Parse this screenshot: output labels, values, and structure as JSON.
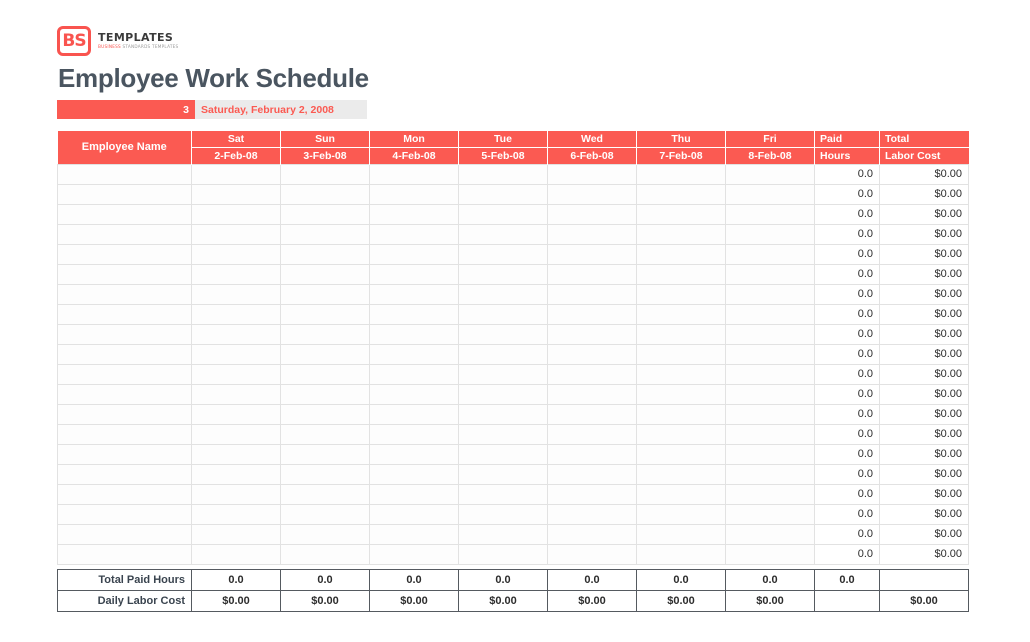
{
  "brand": {
    "mark_text": "BS",
    "name": "TEMPLATES",
    "tagline_accent": "BUSINESS",
    "tagline_rest": " STANDARDS TEMPLATES"
  },
  "header": {
    "title": "Employee Work Schedule",
    "week_number": "3",
    "week_start_date": "Saturday, February 2, 2008"
  },
  "colors": {
    "accent_red": "#fb5a52",
    "banner_gray": "#ebebeb",
    "title_gray": "#4a5560",
    "grid_line": "#e2e2e2",
    "footer_border": "#555a60"
  },
  "table": {
    "employee_col_header": "Employee Name",
    "day_headers": [
      {
        "day": "Sat",
        "date": "2-Feb-08"
      },
      {
        "day": "Sun",
        "date": "3-Feb-08"
      },
      {
        "day": "Mon",
        "date": "4-Feb-08"
      },
      {
        "day": "Tue",
        "date": "5-Feb-08"
      },
      {
        "day": "Wed",
        "date": "6-Feb-08"
      },
      {
        "day": "Thu",
        "date": "7-Feb-08"
      },
      {
        "day": "Fri",
        "date": "8-Feb-08"
      }
    ],
    "paid_header_top": "Paid",
    "paid_header_bottom": "Hours",
    "total_header_top": "Total",
    "total_header_bottom": "Labor Cost",
    "rows": [
      {
        "name": "",
        "days": [
          "",
          "",
          "",
          "",
          "",
          "",
          ""
        ],
        "paid_hours": "0.0",
        "labor_cost": "$0.00"
      },
      {
        "name": "",
        "days": [
          "",
          "",
          "",
          "",
          "",
          "",
          ""
        ],
        "paid_hours": "0.0",
        "labor_cost": "$0.00"
      },
      {
        "name": "",
        "days": [
          "",
          "",
          "",
          "",
          "",
          "",
          ""
        ],
        "paid_hours": "0.0",
        "labor_cost": "$0.00"
      },
      {
        "name": "",
        "days": [
          "",
          "",
          "",
          "",
          "",
          "",
          ""
        ],
        "paid_hours": "0.0",
        "labor_cost": "$0.00"
      },
      {
        "name": "",
        "days": [
          "",
          "",
          "",
          "",
          "",
          "",
          ""
        ],
        "paid_hours": "0.0",
        "labor_cost": "$0.00"
      },
      {
        "name": "",
        "days": [
          "",
          "",
          "",
          "",
          "",
          "",
          ""
        ],
        "paid_hours": "0.0",
        "labor_cost": "$0.00"
      },
      {
        "name": "",
        "days": [
          "",
          "",
          "",
          "",
          "",
          "",
          ""
        ],
        "paid_hours": "0.0",
        "labor_cost": "$0.00"
      },
      {
        "name": "",
        "days": [
          "",
          "",
          "",
          "",
          "",
          "",
          ""
        ],
        "paid_hours": "0.0",
        "labor_cost": "$0.00"
      },
      {
        "name": "",
        "days": [
          "",
          "",
          "",
          "",
          "",
          "",
          ""
        ],
        "paid_hours": "0.0",
        "labor_cost": "$0.00"
      },
      {
        "name": "",
        "days": [
          "",
          "",
          "",
          "",
          "",
          "",
          ""
        ],
        "paid_hours": "0.0",
        "labor_cost": "$0.00"
      },
      {
        "name": "",
        "days": [
          "",
          "",
          "",
          "",
          "",
          "",
          ""
        ],
        "paid_hours": "0.0",
        "labor_cost": "$0.00"
      },
      {
        "name": "",
        "days": [
          "",
          "",
          "",
          "",
          "",
          "",
          ""
        ],
        "paid_hours": "0.0",
        "labor_cost": "$0.00"
      },
      {
        "name": "",
        "days": [
          "",
          "",
          "",
          "",
          "",
          "",
          ""
        ],
        "paid_hours": "0.0",
        "labor_cost": "$0.00"
      },
      {
        "name": "",
        "days": [
          "",
          "",
          "",
          "",
          "",
          "",
          ""
        ],
        "paid_hours": "0.0",
        "labor_cost": "$0.00"
      },
      {
        "name": "",
        "days": [
          "",
          "",
          "",
          "",
          "",
          "",
          ""
        ],
        "paid_hours": "0.0",
        "labor_cost": "$0.00"
      },
      {
        "name": "",
        "days": [
          "",
          "",
          "",
          "",
          "",
          "",
          ""
        ],
        "paid_hours": "0.0",
        "labor_cost": "$0.00"
      },
      {
        "name": "",
        "days": [
          "",
          "",
          "",
          "",
          "",
          "",
          ""
        ],
        "paid_hours": "0.0",
        "labor_cost": "$0.00"
      },
      {
        "name": "",
        "days": [
          "",
          "",
          "",
          "",
          "",
          "",
          ""
        ],
        "paid_hours": "0.0",
        "labor_cost": "$0.00"
      },
      {
        "name": "",
        "days": [
          "",
          "",
          "",
          "",
          "",
          "",
          ""
        ],
        "paid_hours": "0.0",
        "labor_cost": "$0.00"
      },
      {
        "name": "",
        "days": [
          "",
          "",
          "",
          "",
          "",
          "",
          ""
        ],
        "paid_hours": "0.0",
        "labor_cost": "$0.00"
      }
    ],
    "footer": [
      {
        "label": "Total Paid Hours",
        "days": [
          "0.0",
          "0.0",
          "0.0",
          "0.0",
          "0.0",
          "0.0",
          "0.0"
        ],
        "paid_hours": "0.0",
        "labor_cost": ""
      },
      {
        "label": "Daily Labor Cost",
        "days": [
          "$0.00",
          "$0.00",
          "$0.00",
          "$0.00",
          "$0.00",
          "$0.00",
          "$0.00"
        ],
        "paid_hours": "",
        "labor_cost": "$0.00"
      }
    ]
  }
}
